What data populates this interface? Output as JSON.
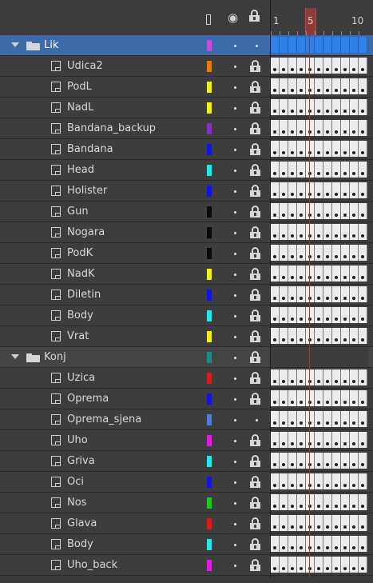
{
  "header": {
    "outline_icon": "outline-icon",
    "eye_icon": "eye-icon",
    "lock_icon": "lock-icon",
    "ruler": {
      "labels": [
        "1",
        "5",
        "10"
      ],
      "current_frame": 5
    }
  },
  "layers": [
    {
      "type": "folder",
      "name": "Lik",
      "color": "#e040e0",
      "selected": true,
      "locked": false
    },
    {
      "type": "layer",
      "name": "Udica2",
      "color": "#f07a00",
      "locked": true
    },
    {
      "type": "layer",
      "name": "PodL",
      "color": "#f4f400",
      "locked": true
    },
    {
      "type": "layer",
      "name": "NadL",
      "color": "#f4f400",
      "locked": true
    },
    {
      "type": "layer",
      "name": "Bandana_backup",
      "color": "#8a2ad0",
      "locked": true
    },
    {
      "type": "layer",
      "name": "Bandana",
      "color": "#1010ff",
      "locked": true
    },
    {
      "type": "layer",
      "name": "Head",
      "color": "#10f0f0",
      "locked": true
    },
    {
      "type": "layer",
      "name": "Holister",
      "color": "#1010ff",
      "locked": true
    },
    {
      "type": "layer",
      "name": "Gun",
      "color": "#0a0a0a",
      "locked": true
    },
    {
      "type": "layer",
      "name": "Nogara",
      "color": "#0a0a0a",
      "locked": true
    },
    {
      "type": "layer",
      "name": "PodK",
      "color": "#0a0a0a",
      "locked": true
    },
    {
      "type": "layer",
      "name": "NadK",
      "color": "#f4f400",
      "locked": true
    },
    {
      "type": "layer",
      "name": "Diletin",
      "color": "#1010ff",
      "locked": true
    },
    {
      "type": "layer",
      "name": "Body",
      "color": "#10f0f0",
      "locked": true
    },
    {
      "type": "layer",
      "name": "Vrat",
      "color": "#f4f400",
      "locked": true
    },
    {
      "type": "folder",
      "name": "Konj",
      "color": "#10908a",
      "selected": false,
      "locked": true
    },
    {
      "type": "layer",
      "name": "Uzica",
      "color": "#f01010",
      "locked": true
    },
    {
      "type": "layer",
      "name": "Oprema",
      "color": "#1010ff",
      "locked": true
    },
    {
      "type": "layer",
      "name": "Oprema_sjena",
      "color": "#4a7ee0",
      "locked": false
    },
    {
      "type": "layer",
      "name": "Uho",
      "color": "#f010f0",
      "locked": true
    },
    {
      "type": "layer",
      "name": "Griva",
      "color": "#10f0f0",
      "locked": true
    },
    {
      "type": "layer",
      "name": "Oci",
      "color": "#1010ff",
      "locked": true
    },
    {
      "type": "layer",
      "name": "Nos",
      "color": "#10d010",
      "locked": true
    },
    {
      "type": "layer",
      "name": "Glava",
      "color": "#f01010",
      "locked": true
    },
    {
      "type": "layer",
      "name": "Body",
      "color": "#10f0f0",
      "locked": true
    },
    {
      "type": "layer",
      "name": "Uho_back",
      "color": "#f010f0",
      "locked": true
    }
  ]
}
